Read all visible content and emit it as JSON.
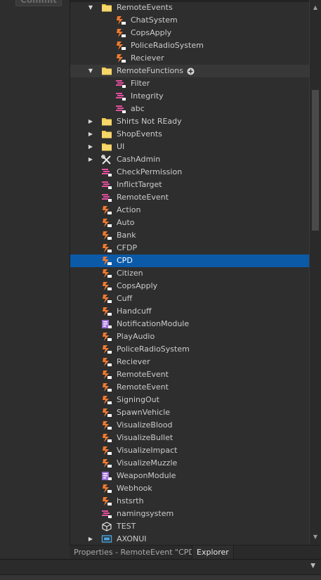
{
  "top": {
    "commit_label": "Commit"
  },
  "colors": {
    "selected": "#0b5aa8",
    "folder": "#f1c84a",
    "remote_event": "#f07a2e",
    "remote_function": "#e24f9e",
    "module": "#9b6cd9"
  },
  "tree": [
    {
      "label": "RemoteEvents",
      "icon": "folder-icon",
      "level": 1,
      "arrow": "expanded"
    },
    {
      "label": "ChatSystem",
      "icon": "remote-event-icon",
      "level": 2
    },
    {
      "label": "CopsApply",
      "icon": "remote-event-icon",
      "level": 2
    },
    {
      "label": "PoliceRadioSystem",
      "icon": "remote-event-icon",
      "level": 2
    },
    {
      "label": "Reciever",
      "icon": "remote-event-icon",
      "level": 2
    },
    {
      "label": "RemoteFunctions",
      "icon": "folder-icon",
      "level": 1,
      "arrow": "expanded",
      "hover": true,
      "plus": true
    },
    {
      "label": "Filter",
      "icon": "remote-function-icon",
      "level": 2
    },
    {
      "label": "Integrity",
      "icon": "remote-function-icon",
      "level": 2
    },
    {
      "label": "abc",
      "icon": "remote-function-icon",
      "level": 2
    },
    {
      "label": "Shirts Not REady",
      "icon": "folder-icon",
      "level": 1,
      "arrow": "collapsed"
    },
    {
      "label": "ShopEvents",
      "icon": "folder-icon",
      "level": 1,
      "arrow": "collapsed"
    },
    {
      "label": "UI",
      "icon": "folder-icon",
      "level": 1,
      "arrow": "collapsed"
    },
    {
      "label": "CashAdmin",
      "icon": "tools-icon",
      "level": 1,
      "arrow": "collapsed"
    },
    {
      "label": "CheckPermission",
      "icon": "remote-function-icon",
      "level": 1
    },
    {
      "label": "InflictTarget",
      "icon": "remote-function-icon",
      "level": 1
    },
    {
      "label": "RemoteEvent",
      "icon": "remote-function-icon",
      "level": 1
    },
    {
      "label": "Action",
      "icon": "remote-event-icon",
      "level": 1
    },
    {
      "label": "Auto",
      "icon": "remote-event-icon",
      "level": 1
    },
    {
      "label": "Bank",
      "icon": "remote-event-icon",
      "level": 1
    },
    {
      "label": "CFDP",
      "icon": "remote-event-icon",
      "level": 1
    },
    {
      "label": "CPD",
      "icon": "remote-event-icon",
      "level": 1,
      "selected": true
    },
    {
      "label": "Citizen",
      "icon": "remote-event-icon",
      "level": 1
    },
    {
      "label": "CopsApply",
      "icon": "remote-event-icon",
      "level": 1
    },
    {
      "label": "Cuff",
      "icon": "remote-event-icon",
      "level": 1
    },
    {
      "label": "Handcuff",
      "icon": "remote-event-icon",
      "level": 1
    },
    {
      "label": "NotificationModule",
      "icon": "module-script-icon",
      "level": 1
    },
    {
      "label": "PlayAudio",
      "icon": "remote-event-icon",
      "level": 1
    },
    {
      "label": "PoliceRadioSystem",
      "icon": "remote-event-icon",
      "level": 1
    },
    {
      "label": "Reciever",
      "icon": "remote-event-icon",
      "level": 1
    },
    {
      "label": "RemoteEvent",
      "icon": "remote-event-icon",
      "level": 1
    },
    {
      "label": "RemoteEvent",
      "icon": "remote-event-icon",
      "level": 1
    },
    {
      "label": "SigningOut",
      "icon": "remote-event-icon",
      "level": 1
    },
    {
      "label": "SpawnVehicle",
      "icon": "remote-event-icon",
      "level": 1
    },
    {
      "label": "VisualizeBlood",
      "icon": "remote-event-icon",
      "level": 1
    },
    {
      "label": "VisualizeBullet",
      "icon": "remote-event-icon",
      "level": 1
    },
    {
      "label": "VisualizeImpact",
      "icon": "remote-event-icon",
      "level": 1
    },
    {
      "label": "VisualizeMuzzle",
      "icon": "remote-event-icon",
      "level": 1
    },
    {
      "label": "WeaponModule",
      "icon": "module-script-icon",
      "level": 1
    },
    {
      "label": "Webhook",
      "icon": "remote-event-icon",
      "level": 1
    },
    {
      "label": "hstsrth",
      "icon": "remote-event-icon",
      "level": 1
    },
    {
      "label": "namingsystem",
      "icon": "remote-function-icon",
      "level": 1
    },
    {
      "label": "TEST",
      "icon": "model-icon",
      "level": 1
    },
    {
      "label": "AXONUI",
      "icon": "screen-gui-icon",
      "level": 1,
      "arrow": "collapsed"
    }
  ],
  "tabs": [
    {
      "label": "Properties - RemoteEvent \"CPD\"",
      "active": false
    },
    {
      "label": "Explorer",
      "active": true
    }
  ]
}
